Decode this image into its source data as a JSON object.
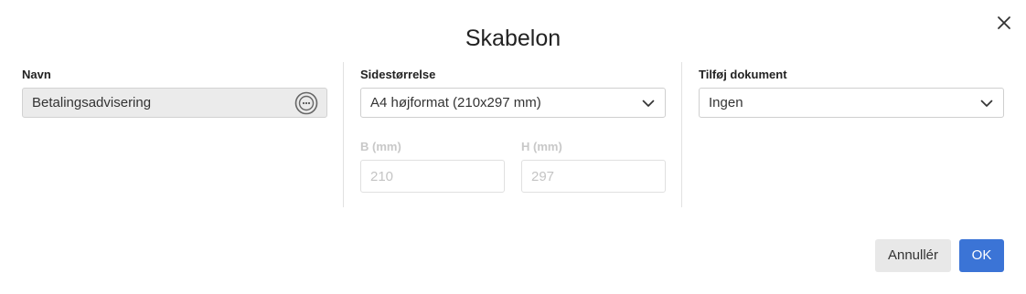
{
  "dialog": {
    "title": "Skabelon"
  },
  "name_field": {
    "label": "Navn",
    "value": "Betalingsadvisering",
    "button_icon": "ellipsis-circle-icon"
  },
  "page_size": {
    "label": "Sidestørrelse",
    "selected": "A4 højformat (210x297 mm)",
    "width_label": "B (mm)",
    "width_value": "210",
    "height_label": "H (mm)",
    "height_value": "297"
  },
  "attach_document": {
    "label": "Tilføj dokument",
    "selected": "Ingen"
  },
  "actions": {
    "cancel_label": "Annullér",
    "ok_label": "OK"
  },
  "colors": {
    "primary": "#3b74d6",
    "readonly_bg": "#ebebeb",
    "disabled_text": "#c4c4c4"
  }
}
